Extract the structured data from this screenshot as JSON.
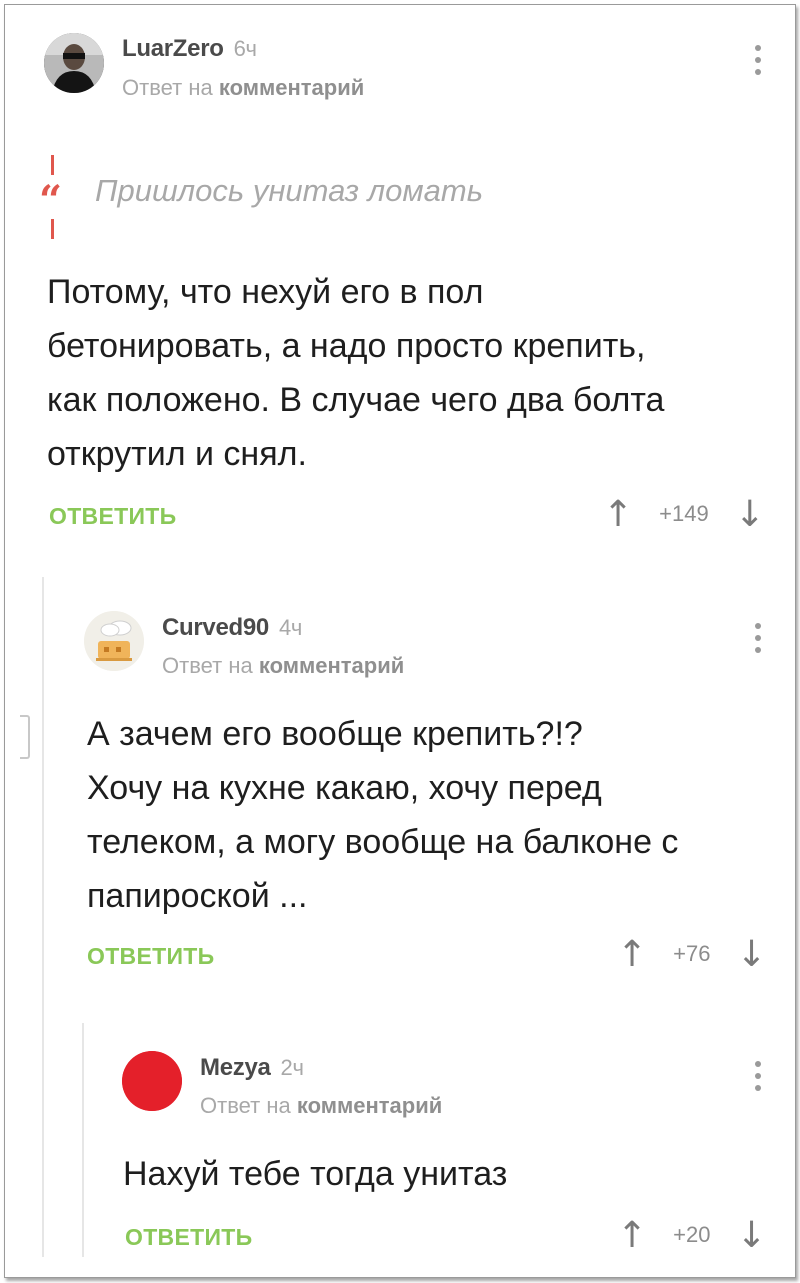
{
  "comments": [
    {
      "author": "LuarZero",
      "time": "6ч",
      "reply_prefix": "Ответ на",
      "reply_target": "комментарий",
      "quote": "Пришлось унитаз ломать",
      "text_lines": [
        "Потому, что нехуй его в пол",
        "бетонировать, а надо просто крепить,",
        "как положено. В случае чего два болта",
        "открутил и снял."
      ],
      "reply_label": "ОТВЕТИТЬ",
      "score": "+149",
      "avatar_icon": "user-photo-avatar"
    },
    {
      "author": "Curved90",
      "time": "4ч",
      "reply_prefix": "Ответ на",
      "reply_target": "комментарий",
      "text_lines": [
        "А зачем его вообще крепить?!?",
        "Хочу на кухне какаю, хочу перед",
        "телеком, а могу вообще на балконе с",
        "папироской ..."
      ],
      "reply_label": "ОТВЕТИТЬ",
      "score": "+76",
      "avatar_icon": "chef-hat-avatar"
    },
    {
      "author": "Mezya",
      "time": "2ч",
      "reply_prefix": "Ответ на",
      "reply_target": "комментарий",
      "text_lines": [
        "Нахуй тебе тогда унитаз"
      ],
      "reply_label": "ОТВЕТИТЬ",
      "score": "+20",
      "avatar_icon": "red-circle-avatar"
    }
  ],
  "icons": {
    "upvote": "↑",
    "downvote": "↓",
    "quote_mark": "“"
  },
  "colors": {
    "accent_green": "#8ac858",
    "quote_red": "#e0574d",
    "avatar_red": "#e4202a"
  }
}
